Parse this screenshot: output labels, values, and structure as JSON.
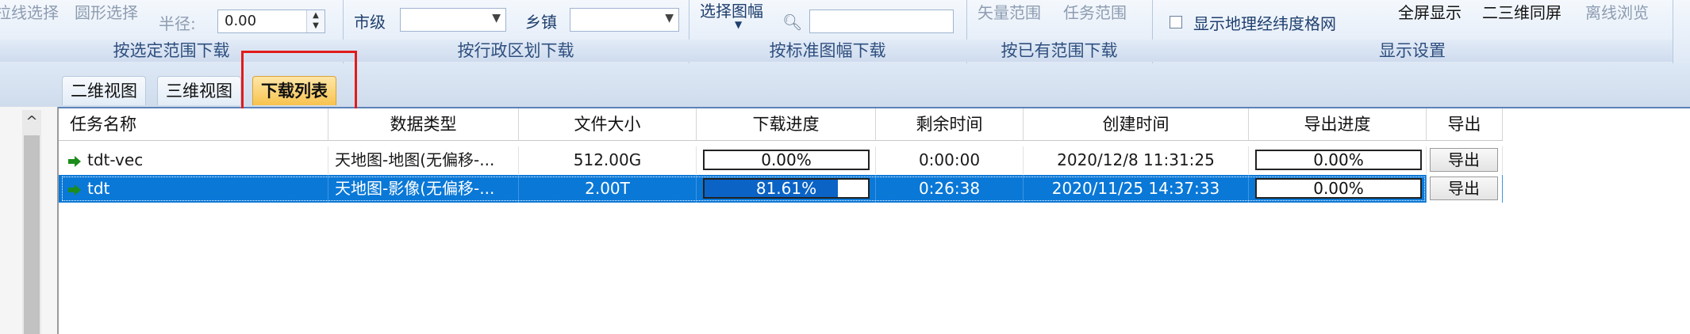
{
  "ribbon": {
    "groups": [
      {
        "label": "按选定范围下载",
        "items": {
          "line_select": "拉线选择",
          "circle_select": "圆形选择",
          "radius_label": "半径:",
          "radius_value": "0.00"
        }
      },
      {
        "label": "按行政区划下载",
        "items": {
          "city_label": "市级",
          "city_value": "",
          "town_label": "乡镇",
          "town_value": ""
        }
      },
      {
        "label": "按标准图幅下载",
        "items": {
          "select_sheet": "选择图幅",
          "search_value": ""
        }
      },
      {
        "label": "按已有范围下载",
        "items": {
          "vector_range": "矢量范围",
          "task_range": "任务范围"
        }
      },
      {
        "label": "显示设置",
        "items": {
          "show_grid": "显示地理经纬度格网",
          "show_grid_checked": false,
          "fullscreen": "全屏显示",
          "sync_2d3d": "二三维同屏",
          "offline_browse": "离线浏览"
        }
      }
    ]
  },
  "tabs": [
    {
      "label": "二维视图",
      "active": false
    },
    {
      "label": "三维视图",
      "active": false
    },
    {
      "label": "下载列表",
      "active": true
    }
  ],
  "grid": {
    "columns": [
      "任务名称",
      "数据类型",
      "文件大小",
      "下载进度",
      "剩余时间",
      "创建时间",
      "导出进度",
      "导出"
    ],
    "rows": [
      {
        "name": "tdt-vec",
        "type": "天地图-地图(无偏移-...",
        "size": "512.00G",
        "progress_text": "0.00%",
        "progress": 0.0,
        "remaining": "0:00:00",
        "created": "2020/12/8 11:31:25",
        "export_progress_text": "0.00%",
        "export_button": "导出",
        "selected": false
      },
      {
        "name": "tdt",
        "type": "天地图-影像(无偏移-...",
        "size": "2.00T",
        "progress_text": "81.61%",
        "progress": 0.8161,
        "remaining": "0:26:38",
        "created": "2020/11/25 14:37:33",
        "export_progress_text": "0.00%",
        "export_button": "导出",
        "selected": true
      }
    ]
  },
  "colors": {
    "selection": "#0a78d7",
    "progress_fill": "#0b63c6",
    "active_tab": "#f7c34e",
    "annotation_box": "#e11b1b"
  }
}
